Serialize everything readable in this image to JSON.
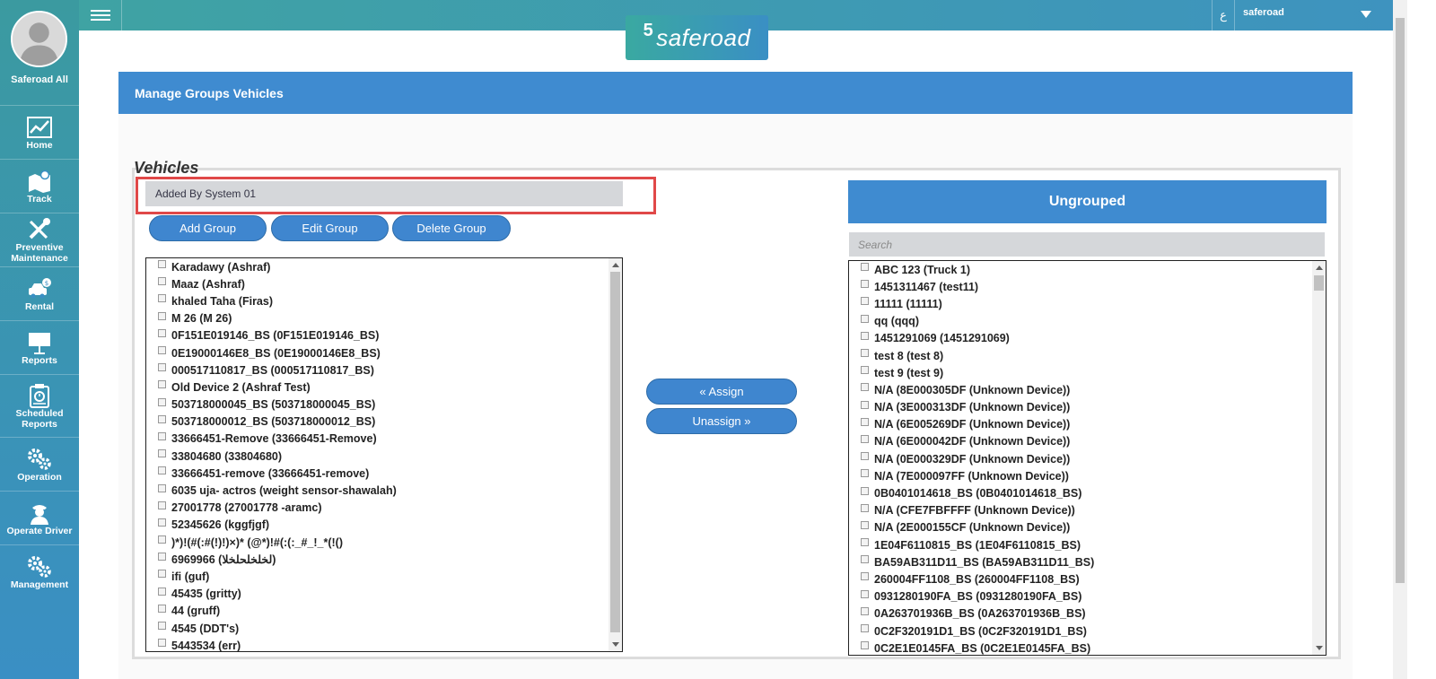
{
  "sidebar": {
    "user_name": "Saferoad All",
    "items": [
      {
        "label": "Home",
        "icon": "chart-icon"
      },
      {
        "label": "Track",
        "icon": "map-icon"
      },
      {
        "label": "Preventive Maintenance",
        "icon": "tools-icon"
      },
      {
        "label": "Rental",
        "icon": "car-dollar-icon"
      },
      {
        "label": "Reports",
        "icon": "presentation-icon"
      },
      {
        "label": "Scheduled Reports",
        "icon": "clipboard-icon"
      },
      {
        "label": "Operation",
        "icon": "gears-icon"
      },
      {
        "label": "Operate Driver",
        "icon": "driver-icon"
      },
      {
        "label": "Management",
        "icon": "gears-icon"
      }
    ]
  },
  "topbar": {
    "lang_label": "ع",
    "user_label": "saferoad",
    "logo_text": "saferoad"
  },
  "panel": {
    "title": "Manage Groups Vehicles",
    "section_title": "Vehicles",
    "selected_group": "Added By System 01",
    "buttons": {
      "add": "Add Group",
      "edit": "Edit Group",
      "delete": "Delete Group",
      "assign": "« Assign",
      "unassign": "Unassign »"
    },
    "group_vehicles": [
      "Karadawy (Ashraf)",
      "Maaz (Ashraf)",
      "khaled Taha (Firas)",
      "M 26 (M 26)",
      "0F151E019146_BS (0F151E019146_BS)",
      "0E19000146E8_BS (0E19000146E8_BS)",
      "000517110817_BS (000517110817_BS)",
      "Old Device 2 (Ashraf Test)",
      "503718000045_BS (503718000045_BS)",
      "503718000012_BS (503718000012_BS)",
      "33666451-Remove (33666451-Remove)",
      "33804680 (33804680)",
      "33666451-remove (33666451-remove)",
      "6035 uja- actros (weight sensor-shawalah)",
      "27001778 (27001778 -aramc)",
      "52345626 (kggfjgf)",
      ")*)!(#(:#(!)!)×)* (@*)!#(:(:_#_!_*(!()",
      "6969966 (لخلخلحلخلا)",
      "ifi (guf)",
      "45435 (gritty)",
      "44 (gruff)",
      "4545 (DDT's)",
      "5443534 (err)"
    ],
    "ungrouped": {
      "title": "Ungrouped",
      "search_placeholder": "Search",
      "vehicles": [
        "ABC 123 (Truck 1)",
        "1451311467 (test11)",
        "11111 (11111)",
        "qq (qqq)",
        "1451291069 (1451291069)",
        "test 8 (test 8)",
        "test 9 (test 9)",
        "N/A (8E000305DF (Unknown Device))",
        "N/A (3E000313DF (Unknown Device))",
        "N/A (6E005269DF (Unknown Device))",
        "N/A (6E000042DF (Unknown Device))",
        "N/A (0E000329DF (Unknown Device))",
        "N/A (7E000097FF (Unknown Device))",
        "0B0401014618_BS (0B0401014618_BS)",
        "N/A (CFE7FBFFFF (Unknown Device))",
        "N/A (2E000155CF (Unknown Device))",
        "1E04F6110815_BS (1E04F6110815_BS)",
        "BA59AB311D11_BS (BA59AB311D11_BS)",
        "260004FF1108_BS (260004FF1108_BS)",
        "0931280190FA_BS (0931280190FA_BS)",
        "0A263701936B_BS (0A263701936B_BS)",
        "0C2F320191D1_BS (0C2F320191D1_BS)",
        "0C2E1E0145FA_BS (0C2E1E0145FA_BS)"
      ]
    }
  }
}
